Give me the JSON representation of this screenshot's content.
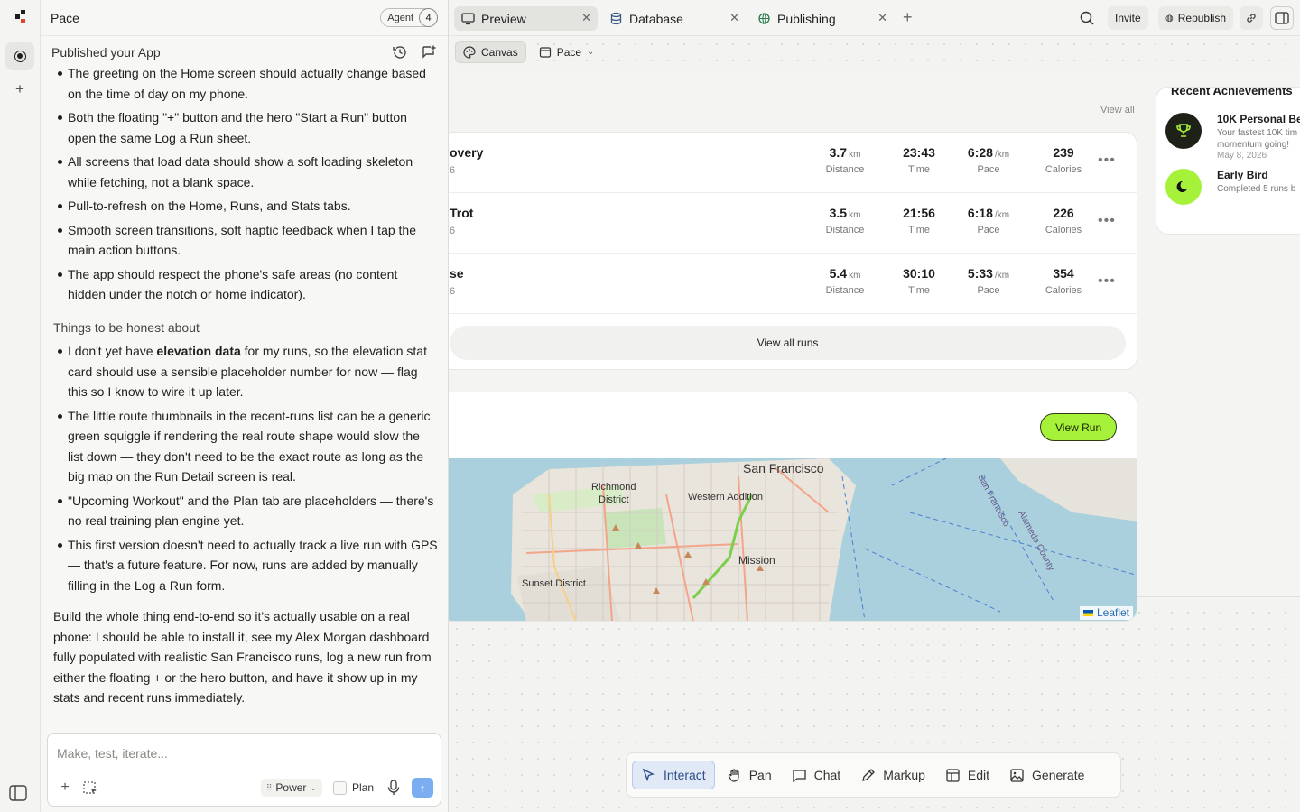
{
  "app": {
    "name": "Pace"
  },
  "header": {
    "agent_label": "Agent",
    "agent_count": "4"
  },
  "chat": {
    "subheader": "Published your App",
    "bullets_top": [
      "The greeting on the Home screen should actually change based on the time of day on my phone.",
      "Both the floating \"+\" button and the hero \"Start a Run\" button open the same Log a Run sheet.",
      "All screens that load data should show a soft loading skeleton while fetching, not a blank space.",
      "Pull-to-refresh on the Home, Runs, and Stats tabs.",
      "Smooth screen transitions, soft haptic feedback when I tap the main action buttons.",
      "The app should respect the phone's safe areas (no content hidden under the notch or home indicator)."
    ],
    "section_title": "Things to be honest about",
    "honest_1_pre": "I don't yet have ",
    "honest_1_bold": "elevation data",
    "honest_1_post": " for my runs, so the elevation stat card should use a sensible placeholder number for now — flag this so I know to wire it up later.",
    "bullets_honest": [
      "The little route thumbnails in the recent-runs list can be a generic green squiggle if rendering the real route shape would slow the list down — they don't need to be the exact route as long as the big map on the Run Detail screen is real.",
      "\"Upcoming Workout\" and the Plan tab are placeholders — there's no real training plan engine yet.",
      "This first version doesn't need to actually track a live run with GPS — that's a future feature. For now, runs are added by manually filling in the Log a Run form."
    ],
    "final_paragraph": "Build the whole thing end-to-end so it's actually usable on a real phone: I should be able to install it, see my Alex Morgan dashboard fully populated with realistic San Francisco runs, log a new run from either the floating + or the hero button, and have it show up in my stats and recent runs immediately."
  },
  "composer": {
    "placeholder": "Make, test, iterate...",
    "power_label": "Power",
    "plan_label": "Plan"
  },
  "tabs": [
    {
      "label": "Preview",
      "active": true
    },
    {
      "label": "Database",
      "active": false
    },
    {
      "label": "Publishing",
      "active": false
    }
  ],
  "top_actions": {
    "invite": "Invite",
    "republish": "Republish"
  },
  "canvas_toolbar": {
    "canvas_label": "Canvas",
    "page_label": "Pace"
  },
  "runs": {
    "view_all_link": "View all",
    "items": [
      {
        "name": "overy",
        "date": "6",
        "distance": "3.7",
        "distance_unit": "km",
        "time": "23:43",
        "pace": "6:28",
        "pace_unit": "/km",
        "calories": "239"
      },
      {
        "name": "Trot",
        "date": "6",
        "distance": "3.5",
        "distance_unit": "km",
        "time": "21:56",
        "pace": "6:18",
        "pace_unit": "/km",
        "calories": "226"
      },
      {
        "name": "se",
        "date": "6",
        "distance": "5.4",
        "distance_unit": "km",
        "time": "30:10",
        "pace": "5:33",
        "pace_unit": "/km",
        "calories": "354"
      }
    ],
    "labels": {
      "distance": "Distance",
      "time": "Time",
      "pace": "Pace",
      "calories": "Calories"
    },
    "view_all_button": "View all runs"
  },
  "map_card": {
    "view_run_button": "View Run",
    "labels": {
      "city": "San Francisco",
      "richmond": "Richmond",
      "district": "District",
      "western": "Western Addition",
      "mission": "Mission",
      "sunset": "Sunset District",
      "alameda": "Alameda County",
      "sf_county": "San Francisco"
    },
    "attribution": "Leaflet"
  },
  "achievements": {
    "title": "Recent Achievements",
    "items": [
      {
        "title": "10K Personal Be",
        "desc_1": "Your fastest 10K tim",
        "desc_2": "momentum going!",
        "date": "May 8, 2026"
      },
      {
        "title": "Early Bird",
        "desc_1": "Completed 5 runs b",
        "desc_2": "",
        "date": ""
      }
    ]
  },
  "dock": [
    {
      "label": "Interact",
      "active": true
    },
    {
      "label": "Pan",
      "active": false
    },
    {
      "label": "Chat",
      "active": false
    },
    {
      "label": "Markup",
      "active": false
    },
    {
      "label": "Edit",
      "active": false
    },
    {
      "label": "Generate",
      "active": false
    }
  ],
  "colors": {
    "accent_green": "#a6f23b",
    "send_blue": "#7aaef0",
    "map_water": "#a9d0dc"
  }
}
